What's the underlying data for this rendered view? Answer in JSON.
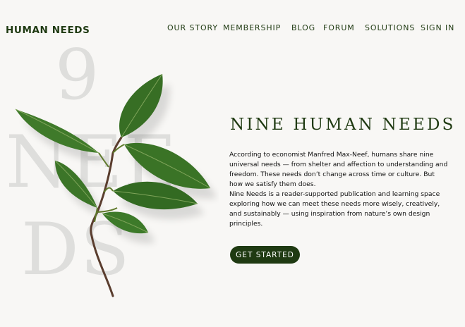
{
  "brand": {
    "name": "HUMAN NEEDS",
    "color": "#1f3a12"
  },
  "nav": {
    "items": [
      {
        "label": "OUR STORY"
      },
      {
        "label": "MEMBERSHIP"
      },
      {
        "label": "BLOG"
      },
      {
        "label": "FORUM"
      },
      {
        "label": "SOLUTIONS"
      },
      {
        "label": "SIGN IN"
      }
    ]
  },
  "background_text": {
    "number": "9",
    "line1": "NEE",
    "line2": "DS"
  },
  "hero": {
    "title": "NINE HUMAN NEEDS",
    "paragraph1": "According to economist Manfred Max-Neef, humans share nine universal needs — from shelter and affection to understanding and freedom. These needs don’t change across time or culture. But how we satisfy them does.",
    "paragraph2": "Nine Needs is a reader-supported publication and learning space exploring how we can meet these needs more wisely, creatively, and sustainably — using inspiration from nature’s own design principles.",
    "cta_label": "GET STARTED",
    "image": "leaf-branch-image"
  },
  "colors": {
    "accent": "#1f3a12",
    "background": "#f8f7f5",
    "watermark": "#dededc"
  }
}
